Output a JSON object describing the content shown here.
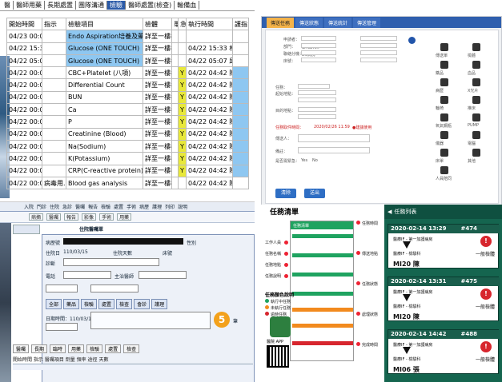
{
  "panel_a": {
    "tabs": [
      "醫",
      "醫師用藥",
      "長期處置",
      "團隊溝通",
      "檢驗",
      "醫師處置(檢查)",
      "輸備血"
    ],
    "active_tab": "檢驗",
    "headers": [
      "開始時間",
      "指示",
      "檢驗項目",
      "檢體",
      "單位",
      "急作",
      "執行時間",
      "護指"
    ],
    "rows": [
      {
        "time": "04/23 00:00",
        "note": "",
        "item": "Endo Aspiration培養及藥物敏感",
        "specimen": "詳至一樓檢...",
        "flag": "",
        "exec": "",
        "hl": true
      },
      {
        "time": "04/22 15:33",
        "note": "",
        "item": "Glucose (ONE TOUCH)",
        "specimen": "詳至一樓檢...",
        "flag": "",
        "exec": "04/22 15:33 林庭翊",
        "hl": true
      },
      {
        "time": "04/22 05:06",
        "note": "",
        "item": "Glucose (ONE TOUCH)",
        "specimen": "詳至一樓檢...",
        "flag": "",
        "exec": "04/22 05:07 邱季伶",
        "hl": true
      },
      {
        "time": "04/22 00:00",
        "note": "",
        "item": "CBC+Platelet (八項)",
        "specimen": "詳至一樓檢...",
        "flag": "Y",
        "exec": "04/22 04:42 陳藝文",
        "hl": false
      },
      {
        "time": "04/22 00:00",
        "note": "",
        "item": "Differential Count",
        "specimen": "詳至一樓檢...",
        "flag": "Y",
        "exec": "04/22 04:42 陳藝文",
        "hl": false
      },
      {
        "time": "04/22 00:00",
        "note": "",
        "item": "BUN",
        "specimen": "詳至一樓檢...",
        "flag": "Y",
        "exec": "04/22 04:42 陳藝文",
        "hl": false
      },
      {
        "time": "04/22 00:00",
        "note": "",
        "item": "Ca",
        "specimen": "詳至一樓檢...",
        "flag": "Y",
        "exec": "04/22 04:42 陳藝文",
        "hl": false
      },
      {
        "time": "04/22 00:00",
        "note": "",
        "item": "P",
        "specimen": "詳至一樓檢...",
        "flag": "Y",
        "exec": "04/22 04:42 陳藝文",
        "hl": false
      },
      {
        "time": "04/22 00:00",
        "note": "",
        "item": "Creatinine (Blood)",
        "specimen": "詳至一樓檢...",
        "flag": "Y",
        "exec": "04/22 04:42 陳藝文",
        "hl": false
      },
      {
        "time": "04/22 00:00",
        "note": "",
        "item": "Na(Sodium)",
        "specimen": "詳至一樓檢...",
        "flag": "Y",
        "exec": "04/22 04:42 陳藝文",
        "hl": false
      },
      {
        "time": "04/22 00:00",
        "note": "",
        "item": "K(Potassium)",
        "specimen": "詳至一樓檢...",
        "flag": "Y",
        "exec": "04/22 04:42 陳藝文",
        "hl": false
      },
      {
        "time": "04/22 00:00",
        "note": "",
        "item": "CRP(C-reactive protein)",
        "specimen": "詳至一樓檢...",
        "flag": "Y",
        "exec": "04/22 04:42 陳藝文",
        "hl": false
      },
      {
        "time": "04/22 00:00",
        "note": "病毒用...",
        "item": "Blood gas analysis",
        "specimen": "詳至一樓檢...",
        "flag": "",
        "exec": "04/22 04:42 陳藝文",
        "hl": false
      }
    ]
  },
  "panel_b": {
    "tabs": [
      "傳送任務",
      "傳送狀態",
      "傳送統計",
      "傳送管理"
    ],
    "labels": {
      "requester": "申請者：",
      "dept": "部門：",
      "phone": "聯絡分機：",
      "bed": "床號：",
      "task": "任務：",
      "from": "起始地點：",
      "to": "目的地點：",
      "pickup": "任務取件時間：",
      "contact": "傳送人：",
      "note": "備註：",
      "urgent": "是否需緊急：",
      "yes": "Yes",
      "no": "No"
    },
    "values": {
      "requester": "SFAdmin",
      "dept": "D5病房",
      "time": "2020/02/26 11:59",
      "hint": "●建議使用"
    },
    "icons": [
      "傳送單",
      "檢體",
      "藥品",
      "血品",
      "病歷",
      "X光片",
      "輪椅",
      "推床",
      "氧氣鋼瓶",
      "PUMP",
      "儀器",
      "電腦",
      "床單",
      "其他",
      "人員陪同"
    ],
    "buttons": {
      "clear": "清除",
      "submit": "送出"
    }
  },
  "panel_c": {
    "menu": [
      "入院",
      "門診",
      "住院",
      "急診",
      "醫囑",
      "報告",
      "檢驗",
      "處置",
      "手術",
      "病歷",
      "護理",
      "列印",
      "說明"
    ],
    "toolbar": [
      "病摘",
      "醫囑",
      "報告",
      "影像",
      "手術",
      "用藥"
    ],
    "window_title": "住院醫囑單",
    "patient_label": "病歷號",
    "fields": {
      "admit": "住院日",
      "admit_val": "110/03/15",
      "days": "住院天數",
      "sex": "性別",
      "bed_label": "床號",
      "diag": "診斷",
      "tel": "電話",
      "doctor": "主治醫師"
    },
    "btn_row": [
      "全部",
      "藥品",
      "檢驗",
      "處置",
      "檢查",
      "會診",
      "護理"
    ],
    "sign_row": "日期時間：110/03/15",
    "bottom_tabs": [
      "醫囑",
      "長期",
      "臨時",
      "用藥",
      "檢驗",
      "處置",
      "檢查"
    ],
    "bottom_header": "開始時間  指示  醫囑項目  劑量  頻率  途徑  天數",
    "count_badge": "5",
    "count_label": "筆"
  },
  "panel_d": {
    "title": "任務清單",
    "side_labels": [
      "工作人員",
      "任務名稱",
      "任務地點",
      "任務說明"
    ],
    "right_labels": [
      "任務時間",
      "傳送地點",
      "任務狀態",
      "處理狀態",
      "完成時間"
    ],
    "color_title": "任務顏色說明",
    "legend": [
      "執行中任務",
      "未執行任務",
      "逾時任務"
    ],
    "qr_label": "醫院 APP",
    "phone_header": "任務清單",
    "app_header": "任務列表",
    "tasks": [
      {
        "date": "2020-02-14 13:29",
        "id": "#474",
        "from": "醫療IF - 第一加護病房",
        "to": "醫療IF - 檢驗科",
        "loc": "MI20 陳",
        "cls": "一般檢體"
      },
      {
        "date": "2020-02-14 13:31",
        "id": "#475",
        "from": "醫療IF - 第一加護病房",
        "to": "醫療IF - 檢驗科",
        "loc": "MI20 陳",
        "cls": "一般檢體"
      },
      {
        "date": "2020-02-14 14:42",
        "id": "#488",
        "from": "醫療IF - 第一加護病房",
        "to": "醫療IF - 檢驗科",
        "loc": "MI06 張",
        "cls": "一般檢體"
      }
    ],
    "colors": {
      "green": "#15654f",
      "red": "#d7262e",
      "orange": "#f28a1e"
    }
  }
}
